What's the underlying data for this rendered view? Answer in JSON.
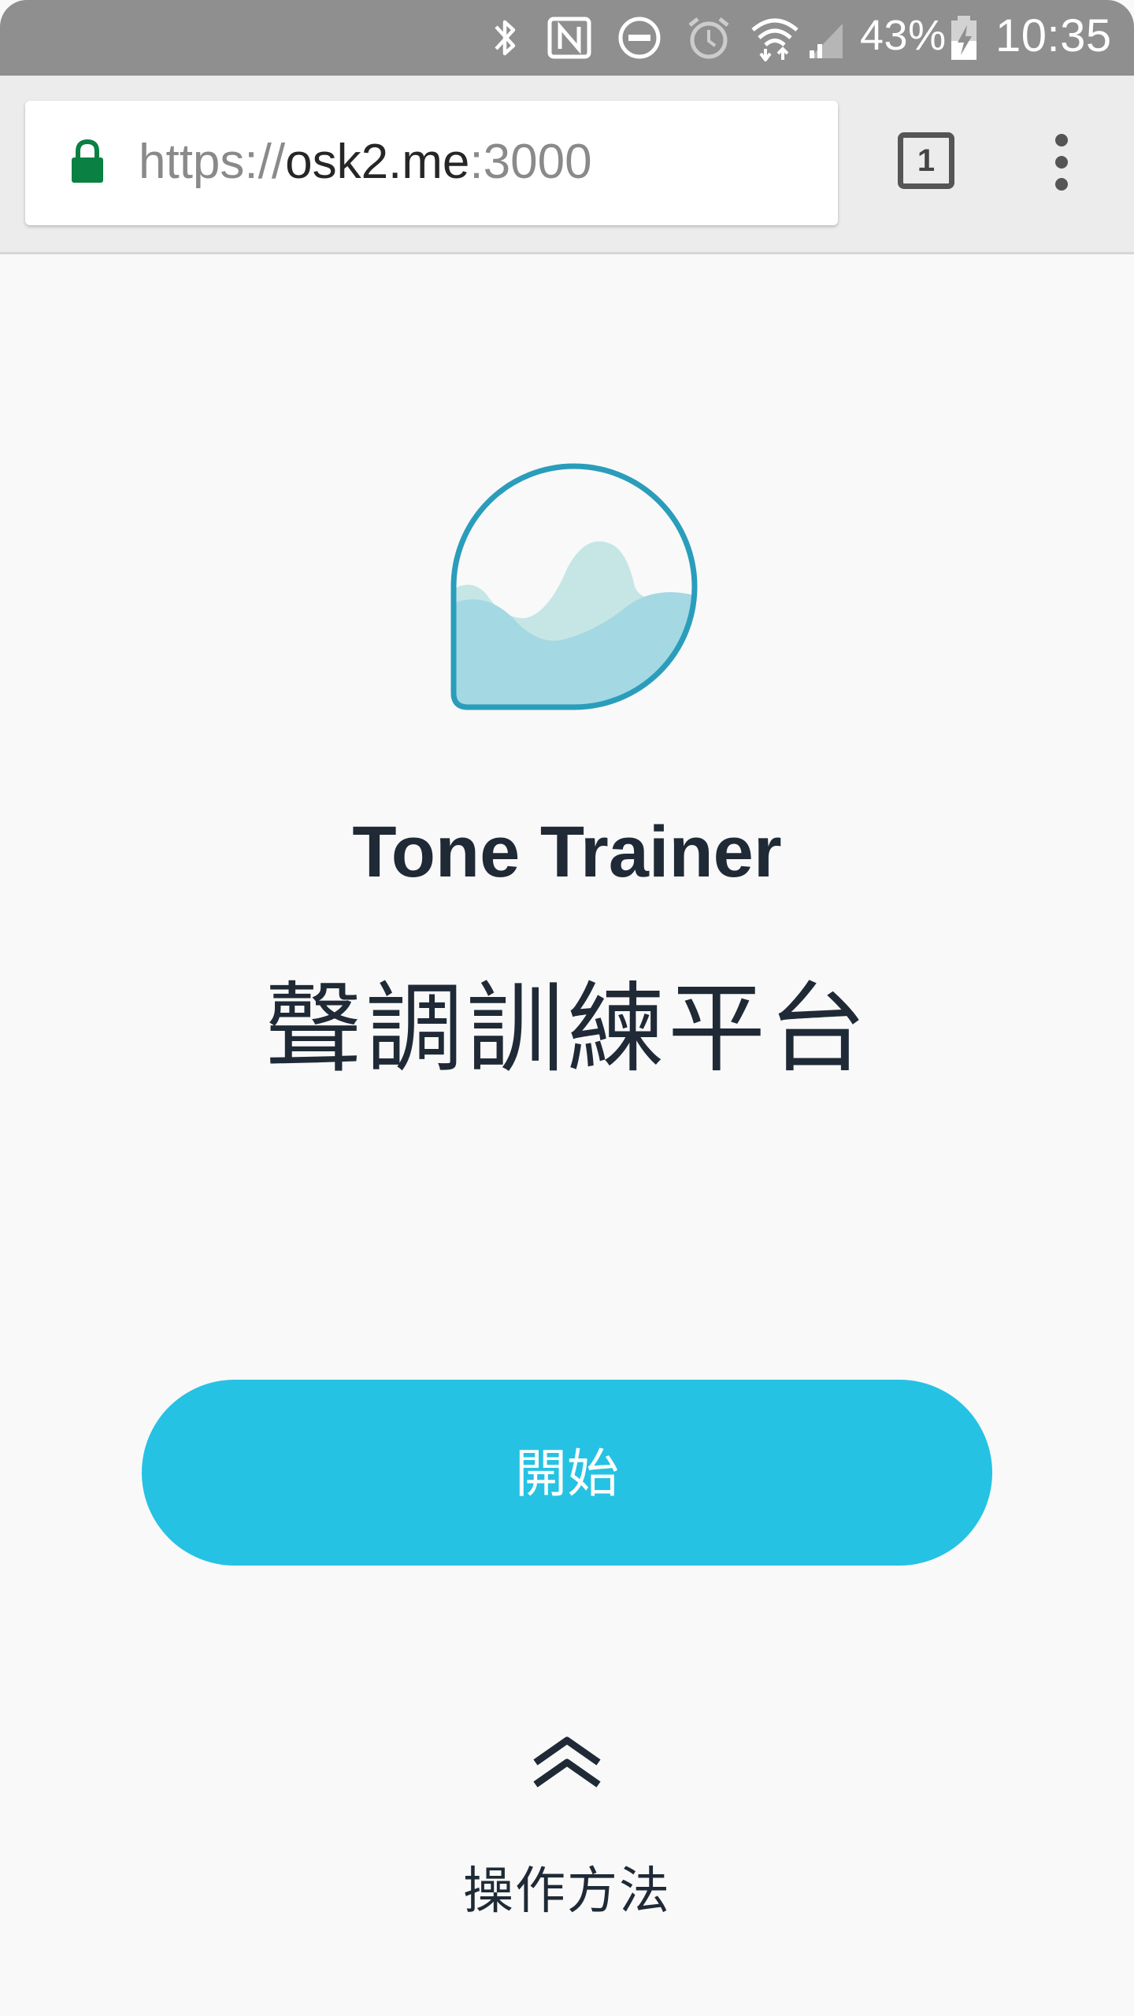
{
  "status_bar": {
    "battery": "43%",
    "time": "10:35",
    "icons": [
      "bluetooth-icon",
      "nfc-icon",
      "do-not-disturb-icon",
      "alarm-icon",
      "wifi-icon",
      "signal-icon",
      "battery-charging-icon"
    ]
  },
  "browser": {
    "url_scheme": "https://",
    "url_host": "osk2.me",
    "url_port": ":3000",
    "tab_count": "1"
  },
  "app": {
    "title": "Tone Trainer",
    "subtitle": "聲調訓練平台",
    "start_label": "開始",
    "instructions_label": "操作方法"
  },
  "colors": {
    "accent": "#25c2e4",
    "logo_outline": "#2a9dbb",
    "text": "#1f2a36",
    "status_bar": "#8f8f8f"
  }
}
